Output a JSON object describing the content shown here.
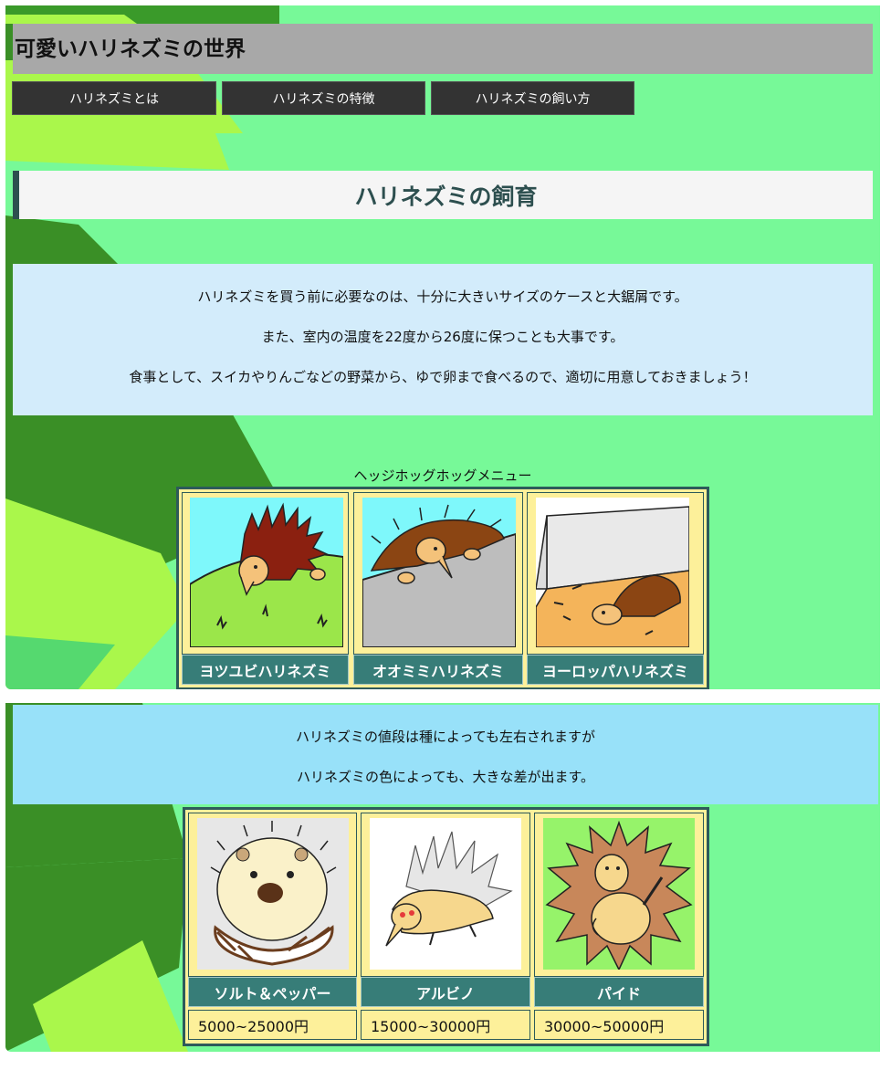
{
  "site_title": "可愛いハリネズミの世界",
  "nav": [
    {
      "label": "ハリネズミとは"
    },
    {
      "label": "ハリネズミの特徴"
    },
    {
      "label": "ハリネズミの飼い方"
    }
  ],
  "section_heading": "ハリネズミの飼育",
  "care_info": [
    "ハリネズミを買う前に必要なのは、十分に大きいサイズのケースと大鋸屑です。",
    "また、室内の温度を22度から26度に保つことも大事です。",
    "食事として、スイカやりんごなどの野菜から、ゆで卵まで食べるので、適切に用意しておきましょう！"
  ],
  "menu_caption": "ヘッジホッグホッグメニュー",
  "species": [
    {
      "name": "ヨツユビハリネズミ",
      "icon": "hedgehog-on-hill-icon"
    },
    {
      "name": "オオミミハリネズミ",
      "icon": "hedgehog-peeking-icon"
    },
    {
      "name": "ヨーロッパハリネズミ",
      "icon": "hedgehog-in-cage-icon"
    }
  ],
  "price_info": [
    "ハリネズミの値段は種によっても左右されますが",
    "ハリネズミの色によっても、大きな差が出ます。"
  ],
  "colors": [
    {
      "name": "ソルト＆ペッパー",
      "price": "5000~25000円",
      "icon": "salt-pepper-hedgehog-icon"
    },
    {
      "name": "アルビノ",
      "price": "15000~30000円",
      "icon": "albino-hedgehog-icon"
    },
    {
      "name": "パイド",
      "price": "30000~50000円",
      "icon": "pied-hedgehog-icon"
    }
  ],
  "theme": {
    "background": "#77f998",
    "nav": "#333333",
    "accent": "#377d78",
    "cell": "#fdf09a"
  }
}
